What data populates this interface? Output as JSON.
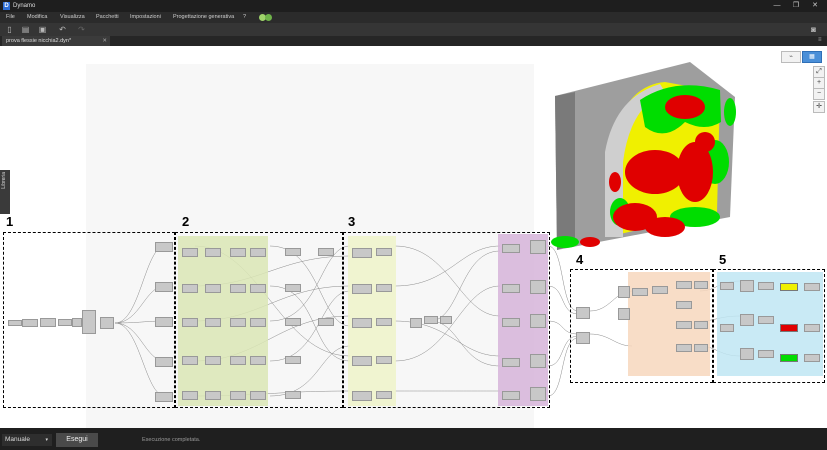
{
  "window": {
    "title": "Dynamo",
    "minimize": "—",
    "maximize": "❐",
    "close": "✕"
  },
  "menu": [
    "File",
    "Modifica",
    "Visualizza",
    "Pacchetti",
    "Impostazioni",
    "Progettazione generativa",
    "?"
  ],
  "tab": {
    "label": "prova flessie nicchia2.dyn*",
    "close": "✕"
  },
  "library": {
    "label": "Libreria"
  },
  "zoom": {
    "fit": "⤢",
    "in": "+",
    "out": "−",
    "pan": "✛"
  },
  "annotations": [
    "1",
    "2",
    "3",
    "4",
    "5"
  ],
  "run": {
    "mode": "Manuale",
    "mode_arrow": "▾",
    "button": "Esegui",
    "status": "Esecuzione completata."
  },
  "colors": {
    "green_group": "#dbe6b5",
    "light_green_group": "#eef3c9",
    "purple_group": "#d6b4d9",
    "orange_group": "#f7d7bd",
    "blue_group": "#bfe6f3",
    "heat_red": "#e00000",
    "heat_yellow": "#f0f000",
    "heat_green": "#00dd00"
  }
}
